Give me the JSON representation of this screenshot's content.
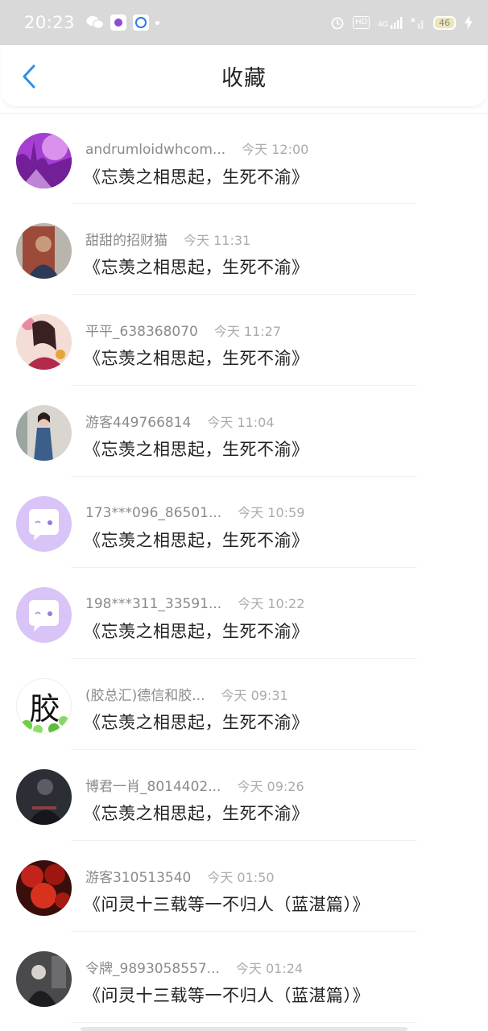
{
  "status_bar": {
    "time": "20:23",
    "hd": "HD",
    "network": "4G",
    "battery": "46"
  },
  "header": {
    "title": "收藏",
    "back_icon": "chevron-left-icon",
    "accent": "#2f8fe6"
  },
  "items": [
    {
      "user": "andrumloidwhcom...",
      "time": "今天 12:00",
      "title": "《忘羡之相思起，生死不渝》",
      "avatar": "purple-forest"
    },
    {
      "user": "甜甜的招财猫",
      "time": "今天 11:31",
      "title": "《忘羡之相思起，生死不渝》",
      "avatar": "portrait-uniform"
    },
    {
      "user": "平平_638368070",
      "time": "今天 11:27",
      "title": "《忘羡之相思起，生死不渝》",
      "avatar": "costume-girl"
    },
    {
      "user": "游客449766814",
      "time": "今天 11:04",
      "title": "《忘羡之相思起，生死不渝》",
      "avatar": "qipao-lady"
    },
    {
      "user": "173***096_86501...",
      "time": "今天 10:59",
      "title": "《忘羡之相思起，生死不渝》",
      "avatar": "default-bubble"
    },
    {
      "user": "198***311_33591...",
      "time": "今天 10:22",
      "title": "《忘羡之相思起，生死不渝》",
      "avatar": "default-bubble"
    },
    {
      "user": "(胶总汇)德信和胶...",
      "time": "今天 09:31",
      "title": "《忘羡之相思起，生死不渝》",
      "avatar": "glue-character",
      "avatar_text": "胶"
    },
    {
      "user": "博君一肖_8014402...",
      "time": "今天 09:26",
      "title": "《忘羡之相思起，生死不渝》",
      "avatar": "dark-figure"
    },
    {
      "user": "游客310513540",
      "time": "今天 01:50",
      "title": "《问灵十三载等一不归人（蓝湛篇）》",
      "avatar": "red-maple"
    },
    {
      "user": "令牌_9893058557...",
      "time": "今天 01:24",
      "title": "《问灵十三载等一不归人（蓝湛篇）》",
      "avatar": "dark-sitting"
    }
  ]
}
